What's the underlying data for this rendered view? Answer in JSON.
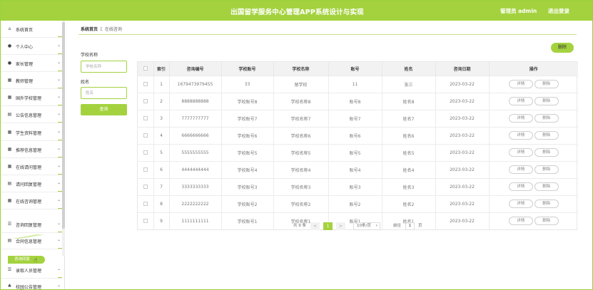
{
  "header": {
    "title": "出国留学服务中心管理APP系统设计与实现",
    "user_label": "管理员 admin",
    "logout_label": "退出登录"
  },
  "sidebar": {
    "items": [
      {
        "label": "系统首页",
        "icon": "home-icon",
        "glyph": "⌂",
        "chevron": false
      },
      {
        "label": "个人中心",
        "icon": "user-icon",
        "glyph": "●",
        "chevron": true
      },
      {
        "label": "家长管理",
        "icon": "person-icon",
        "glyph": "●",
        "chevron": true
      },
      {
        "label": "教师管理",
        "icon": "grid-icon",
        "glyph": "▦",
        "chevron": true
      },
      {
        "label": "国外学校管理",
        "icon": "grid-icon",
        "glyph": "▦",
        "chevron": true
      },
      {
        "label": "公告信息管理",
        "icon": "document-icon",
        "glyph": "▤",
        "chevron": true
      },
      {
        "label": "学生资料管理",
        "icon": "grid-icon",
        "glyph": "▦",
        "chevron": true
      },
      {
        "label": "推荐信息管理",
        "icon": "grid-icon",
        "glyph": "▦",
        "chevron": true
      },
      {
        "label": "在线请问管理",
        "icon": "grid-icon",
        "glyph": "▦",
        "chevron": true
      },
      {
        "label": "请问回复管理",
        "icon": "document-icon",
        "glyph": "▤",
        "chevron": true
      },
      {
        "label": "在线咨询管理",
        "icon": "grid-icon",
        "glyph": "▦",
        "chevron": true
      },
      {
        "label": "咨询回复管理",
        "icon": "list-icon",
        "glyph": "☰",
        "chevron": true
      },
      {
        "label": "合同信息管理",
        "icon": "document-icon",
        "glyph": "▤",
        "chevron": true
      },
      {
        "label": "录取人员管理",
        "icon": "list-icon",
        "glyph": "☰",
        "chevron": true
      },
      {
        "label": "校园公告管理",
        "icon": "tree-icon",
        "glyph": "♣",
        "chevron": true
      }
    ],
    "active_sub_item": "咨询回复"
  },
  "breadcrumb": {
    "home": "系统首页",
    "separator": "Σ",
    "current": "在线咨询"
  },
  "search": {
    "school_label": "学校名称",
    "school_placeholder": "学校名称",
    "name_label": "姓名",
    "name_placeholder": "姓名",
    "query_button": "查询"
  },
  "toolbar": {
    "delete_label": "删除"
  },
  "table": {
    "headers": [
      "",
      "索引",
      "咨询编号",
      "学校账号",
      "学校名称",
      "账号",
      "姓名",
      "咨询日期",
      "操作"
    ],
    "detail_label": "详情",
    "delete_label": "删除",
    "rows": [
      {
        "index": "1",
        "code": "1679473979455",
        "school_account": "33",
        "school_name": "留学校",
        "account": "11",
        "name": "张三",
        "date": "2023-03-22"
      },
      {
        "index": "2",
        "code": "8888888888",
        "school_account": "学校账号8",
        "school_name": "学校名称8",
        "account": "账号8",
        "name": "姓名8",
        "date": "2023-03-22"
      },
      {
        "index": "3",
        "code": "7777777777",
        "school_account": "学校账号7",
        "school_name": "学校名称7",
        "account": "账号7",
        "name": "姓名7",
        "date": "2023-03-22"
      },
      {
        "index": "4",
        "code": "6666666666",
        "school_account": "学校账号6",
        "school_name": "学校名称6",
        "account": "账号6",
        "name": "姓名6",
        "date": "2023-03-22"
      },
      {
        "index": "5",
        "code": "5555555555",
        "school_account": "学校账号5",
        "school_name": "学校名称5",
        "account": "账号5",
        "name": "姓名5",
        "date": "2023-03-22"
      },
      {
        "index": "6",
        "code": "4444444444",
        "school_account": "学校账号4",
        "school_name": "学校名称4",
        "account": "账号4",
        "name": "姓名4",
        "date": "2023-03-22"
      },
      {
        "index": "7",
        "code": "3333333333",
        "school_account": "学校账号3",
        "school_name": "学校名称3",
        "account": "账号3",
        "name": "姓名3",
        "date": "2023-03-22"
      },
      {
        "index": "8",
        "code": "2222222222",
        "school_account": "学校账号2",
        "school_name": "学校名称2",
        "account": "账号2",
        "name": "姓名2",
        "date": "2023-03-22"
      },
      {
        "index": "9",
        "code": "1111111111",
        "school_account": "学校账号1",
        "school_name": "学校名称1",
        "account": "账号1",
        "name": "姓名1",
        "date": "2023-03-22"
      }
    ]
  },
  "pagination": {
    "total_text": "共 9 条",
    "prev": "<",
    "current_page": "1",
    "next": ">",
    "page_size": "10条/页",
    "goto_label": "前往",
    "goto_value": "1",
    "page_suffix": "页"
  },
  "colors": {
    "accent": "#a4d23f"
  }
}
